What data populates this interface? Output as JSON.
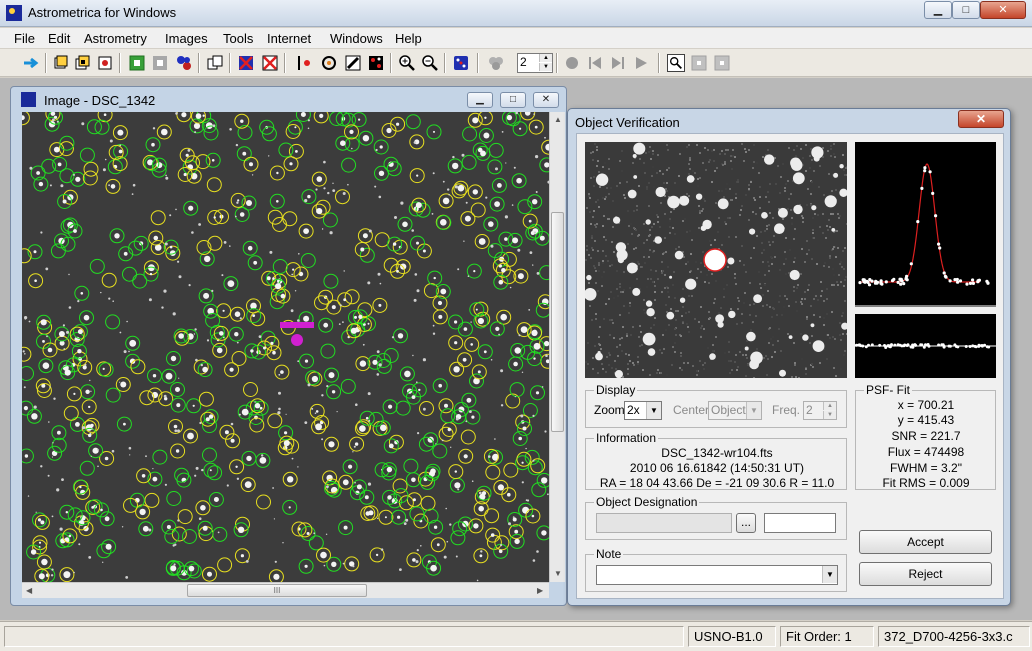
{
  "app": {
    "title": "Astrometrica for Windows",
    "caption_buttons": {
      "minimize": "▁",
      "maximize": "□",
      "close": "✕"
    }
  },
  "menu": [
    "File",
    "Edit",
    "Astrometry",
    "Images",
    "Tools",
    "Internet",
    "Windows",
    "Help"
  ],
  "toolbar": {
    "spin_value": "2",
    "icons": [
      "connect-icon",
      "open-image-icon",
      "open-images-icon",
      "settings-icon",
      "start-data-reduction-icon",
      "star-chart-icon",
      "pair-images-icon",
      "blink-icon",
      "delete-image-icon",
      "close-image-icon",
      "moving-object-icon",
      "track-and-stack-icon",
      "draw-line-icon",
      "color-stack-icon",
      "zoom-in-icon",
      "zoom-out-icon",
      "dice-icon",
      "group-icon",
      "record-icon",
      "step-back-icon",
      "step-forward-icon",
      "play-icon",
      "zoom-window-icon",
      "window-a-icon",
      "window-b-icon"
    ]
  },
  "image_window": {
    "title": "Image - DSC_1342"
  },
  "dialog": {
    "title": "Object Verification",
    "close_label": "✕",
    "display": {
      "group_label": "Display",
      "zoom_label": "Zoom",
      "zoom_value": "2x",
      "center_label": "Center",
      "center_value": "Object",
      "freq_label": "Freq.",
      "freq_value": "2"
    },
    "information": {
      "group_label": "Information",
      "filename": "DSC_1342-wr104.fts",
      "datetime": "2010 06 16.61842 (14:50:31 UT)",
      "coords": "RA = 18 04 43.66   De = -21 09 30.6   R = 11.0"
    },
    "psf_fit": {
      "group_label": "PSF- Fit",
      "x": "x = 700.21",
      "y": "y = 415.43",
      "snr": "SNR = 221.7",
      "flux": "Flux = 474498",
      "fwhm": "FWHM = 3.2\"",
      "fit_rms": "Fit RMS = 0.009"
    },
    "designation": {
      "group_label": "Object Designation",
      "value": "",
      "browse_label": "...",
      "extra": ""
    },
    "note": {
      "group_label": "Note",
      "value": ""
    },
    "accept_label": "Accept",
    "reject_label": "Reject"
  },
  "statusbar": {
    "catalog": "USNO-B1.0",
    "fit_order": "Fit Order: 1",
    "file": "372_D700-4256-3x3.c"
  },
  "colors": {
    "catalog_green": "#22dd22",
    "catalog_yellow": "#e8e020",
    "target_magenta": "#d020d0",
    "psf_curve": "#dd2020"
  }
}
